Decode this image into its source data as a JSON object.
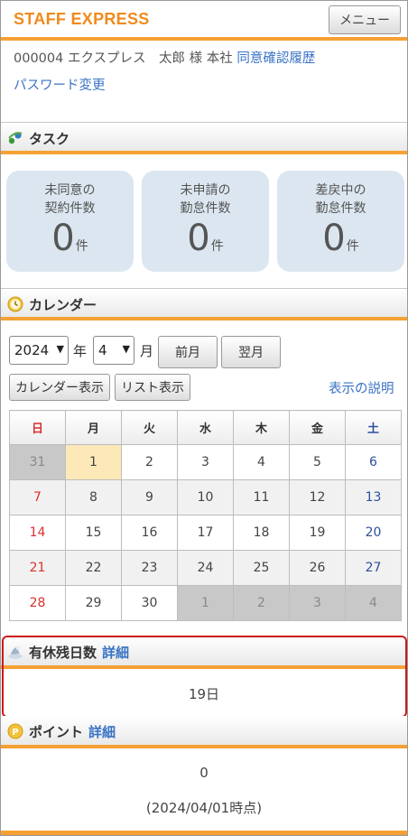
{
  "header": {
    "logo": "STAFF EXPRESS",
    "menu_label": "メニュー"
  },
  "user": {
    "info": "000004 エクスプレス　太郎 様 本社",
    "consent_link": "同意確認履歴",
    "password_link": "パスワード変更"
  },
  "task": {
    "title": "タスク",
    "cards": [
      {
        "line1": "未同意の",
        "line2": "契約件数",
        "count": "0",
        "unit": "件"
      },
      {
        "line1": "未申請の",
        "line2": "勤怠件数",
        "count": "0",
        "unit": "件"
      },
      {
        "line1": "差戻中の",
        "line2": "勤怠件数",
        "count": "0",
        "unit": "件"
      }
    ]
  },
  "calendar": {
    "title": "カレンダー",
    "year": "2024",
    "year_unit": "年",
    "month": "4",
    "month_unit": "月",
    "prev_label": "前月",
    "next_label": "翌月",
    "calendar_view_label": "カレンダー表示",
    "list_view_label": "リスト表示",
    "help_link": "表示の説明",
    "weekdays": [
      "日",
      "月",
      "火",
      "水",
      "木",
      "金",
      "土"
    ],
    "weeks": [
      [
        "31",
        "1",
        "2",
        "3",
        "4",
        "5",
        "6"
      ],
      [
        "7",
        "8",
        "9",
        "10",
        "11",
        "12",
        "13"
      ],
      [
        "14",
        "15",
        "16",
        "17",
        "18",
        "19",
        "20"
      ],
      [
        "21",
        "22",
        "23",
        "24",
        "25",
        "26",
        "27"
      ],
      [
        "28",
        "29",
        "30",
        "1",
        "2",
        "3",
        "4"
      ]
    ]
  },
  "paid_leave": {
    "title": "有休残日数",
    "detail_link": "詳細",
    "value": "19日"
  },
  "points": {
    "title": "ポイント",
    "detail_link": "詳細",
    "value": "0",
    "as_of": "(2024/04/01時点)"
  }
}
